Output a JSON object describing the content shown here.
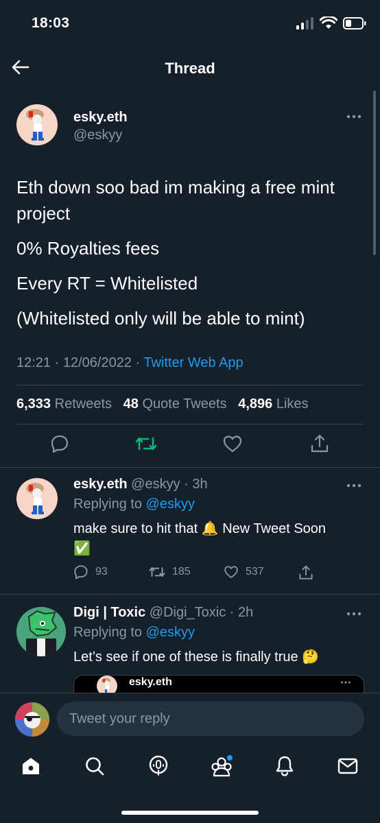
{
  "status_bar": {
    "time": "18:03"
  },
  "nav": {
    "title": "Thread"
  },
  "main_tweet": {
    "name": "esky.eth",
    "handle": "@eskyy",
    "text": [
      "Eth down soo bad im making a free mint project",
      "0% Royalties fees",
      "Every RT = Whitelisted",
      "(Whitelisted only will be able to mint)"
    ],
    "time": "12:21",
    "date": "12/06/2022",
    "source": "Twitter Web App",
    "retweets_count": "6,333",
    "retweets_label": "Retweets",
    "quote_count": "48",
    "quote_label": "Quote Tweets",
    "likes_count": "4,896",
    "likes_label": "Likes"
  },
  "replies": [
    {
      "name": "esky.eth",
      "handle": "@eskyy",
      "age": "3h",
      "replying_prefix": "Replying to",
      "replying_to": "@eskyy",
      "text_line1": "make sure to hit that 🔔 New Tweet Soon",
      "text_line2": "✅",
      "reply_count": "93",
      "retweet_count": "185",
      "like_count": "537"
    },
    {
      "name": "Digi | Toxic",
      "handle": "@Digi_Toxic",
      "age": "2h",
      "replying_prefix": "Replying to",
      "replying_to": "@eskyy",
      "text_line1": "Let’s see if one of these is finally true 🤔",
      "quoted_name": "esky.eth"
    }
  ],
  "composer": {
    "placeholder": "Tweet your reply"
  },
  "colors": {
    "background": "#15202b",
    "accent": "#1d9bf0",
    "retweet_active": "#00ba7c",
    "muted": "#8899a6"
  }
}
